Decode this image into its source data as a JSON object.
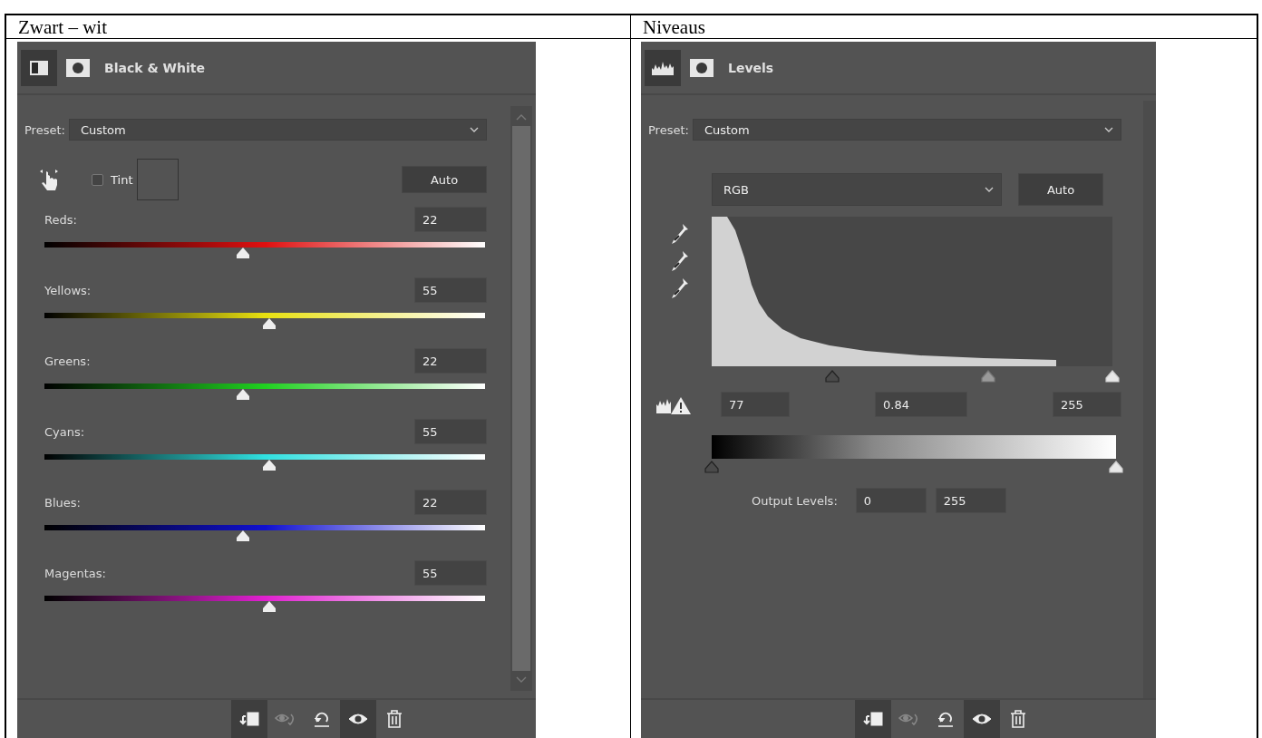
{
  "table": {
    "headers": [
      "Zwart – wit",
      "Niveaus"
    ]
  },
  "bw_panel": {
    "title": "Black & White",
    "preset_label": "Preset:",
    "preset": "Custom",
    "tint_label": "Tint",
    "tint_checked": false,
    "auto": "Auto",
    "sliders": [
      {
        "name": "Reds:",
        "value": "22",
        "level": 0.45,
        "color": "#e01010"
      },
      {
        "name": "Yellows:",
        "value": "55",
        "level": 0.51,
        "color": "#e8e010"
      },
      {
        "name": "Greens:",
        "value": "22",
        "level": 0.45,
        "color": "#20d020"
      },
      {
        "name": "Cyans:",
        "value": "55",
        "level": 0.51,
        "color": "#30e0e0"
      },
      {
        "name": "Blues:",
        "value": "22",
        "level": 0.45,
        "color": "#1010d0"
      },
      {
        "name": "Magentas:",
        "value": "55",
        "level": 0.51,
        "color": "#e020d0"
      }
    ],
    "toolbar": [
      {
        "kind": "clip",
        "pressed": true,
        "disabled": false
      },
      {
        "kind": "previous",
        "pressed": false,
        "disabled": true
      },
      {
        "kind": "reset",
        "pressed": false,
        "disabled": false
      },
      {
        "kind": "visibility",
        "pressed": true,
        "disabled": false
      },
      {
        "kind": "delete",
        "pressed": false,
        "disabled": false
      }
    ]
  },
  "levels_panel": {
    "title": "Levels",
    "preset_label": "Preset:",
    "preset": "Custom",
    "channel": "RGB",
    "auto": "Auto",
    "input_sliders": [
      {
        "kind": "black",
        "level": 0.3
      },
      {
        "kind": "gray",
        "level": 0.69
      },
      {
        "kind": "white",
        "level": 1
      }
    ],
    "inputs": [
      "77",
      "0.84",
      "255"
    ],
    "output_sliders": [
      {
        "kind": "black",
        "level": 0
      },
      {
        "kind": "white",
        "level": 1
      }
    ],
    "output_label": "Output Levels:",
    "outputs": [
      "0",
      "255"
    ],
    "toolbar": [
      {
        "kind": "clip",
        "pressed": true,
        "disabled": false
      },
      {
        "kind": "previous",
        "pressed": false,
        "disabled": true
      },
      {
        "kind": "reset",
        "pressed": false,
        "disabled": false
      },
      {
        "kind": "visibility",
        "pressed": true,
        "disabled": false
      },
      {
        "kind": "delete",
        "pressed": false,
        "disabled": false
      }
    ]
  }
}
